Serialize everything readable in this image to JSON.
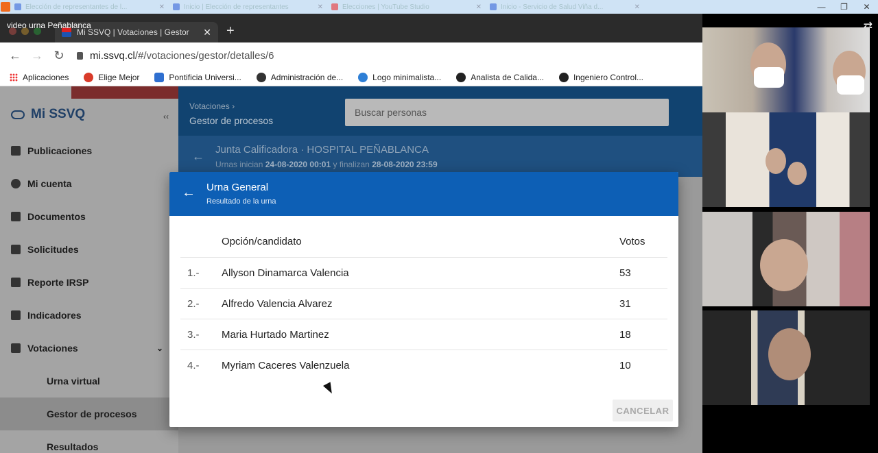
{
  "os_bar": {
    "tabs": [
      "Elección de representantes de l...",
      "Inicio | Elección de representantes",
      "Elecciones | YouTube Studio",
      "Inicio - Servicio de Salud Viña d..."
    ]
  },
  "video": {
    "title": "video urna Peñablanca"
  },
  "browser": {
    "tab_title": "Mi SSVQ | Votaciones | Gestor",
    "url_host": "mi.ssvq.cl",
    "url_path": "/#/votaciones/gestor/detalles/6",
    "bookmarks": [
      "Aplicaciones",
      "Elige Mejor",
      "Pontificia Universi...",
      "Administración de...",
      "Logo minimalista...",
      "Analista de Calida...",
      "Ingeniero Control..."
    ]
  },
  "sidebar": {
    "brand": "Mi SSVQ",
    "items": [
      {
        "label": "Publicaciones"
      },
      {
        "label": "Mi cuenta"
      },
      {
        "label": "Documentos"
      },
      {
        "label": "Solicitudes"
      },
      {
        "label": "Reporte IRSP"
      },
      {
        "label": "Indicadores"
      },
      {
        "label": "Votaciones"
      }
    ],
    "sub_items": [
      {
        "label": "Urna virtual"
      },
      {
        "label": "Gestor de procesos"
      },
      {
        "label": "Resultados"
      }
    ]
  },
  "header": {
    "breadcrumb": "Votaciones",
    "title": "Gestor de procesos",
    "search_placeholder": "Buscar personas"
  },
  "event": {
    "title": "Junta Calificadora · HOSPITAL PEÑABLANCA",
    "sub_prefix": "Urnas inician",
    "start": "24-08-2020 00:01",
    "sub_mid": "y finalizan",
    "end": "28-08-2020 23:59"
  },
  "modal": {
    "title": "Urna General",
    "subtitle": "Resultado de la urna",
    "col_option": "Opción/candidato",
    "col_votes": "Votos",
    "rows": [
      {
        "num": "1.-",
        "name": "Allyson Dinamarca Valencia",
        "votes": "53"
      },
      {
        "num": "2.-",
        "name": "Alfredo Valencia Alvarez",
        "votes": "31"
      },
      {
        "num": "3.-",
        "name": "Maria Hurtado Martinez",
        "votes": "18"
      },
      {
        "num": "4.-",
        "name": "Myriam Caceres Valenzuela",
        "votes": "10"
      }
    ],
    "cancel_label": "CANCELAR"
  }
}
